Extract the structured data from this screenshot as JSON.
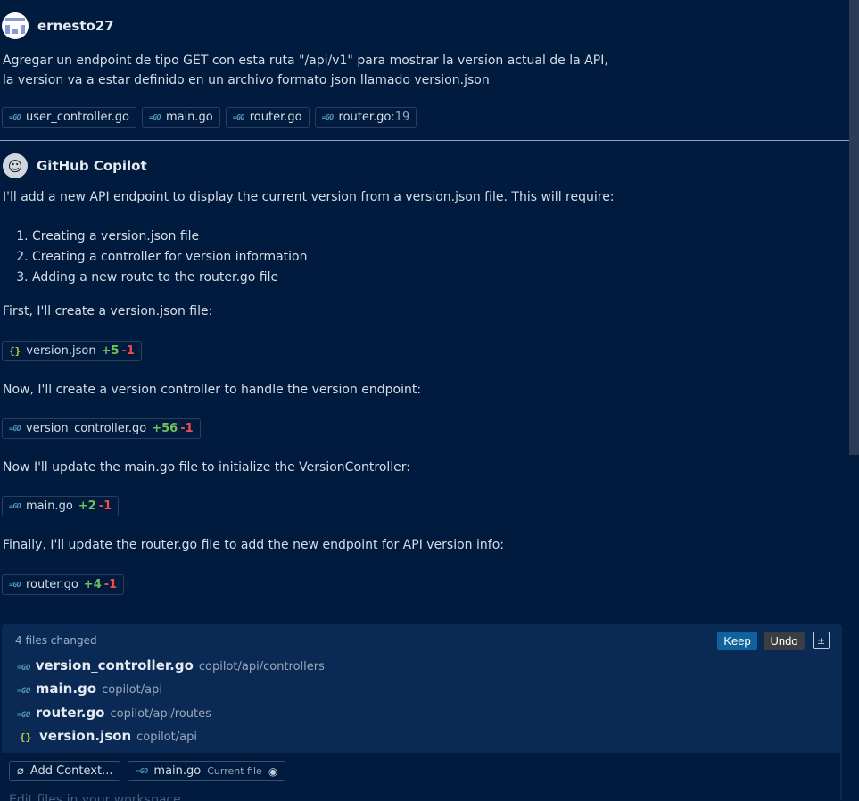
{
  "user": {
    "name": "ernesto27",
    "message_line1": "Agregar un endpoint de tipo GET con esta ruta \"/api/v1\" para mostrar la version actual de la API,",
    "message_line2": "la version va a estar definido en un archivo formato json llamado version.json",
    "attachments": [
      {
        "icon": "go-file-icon",
        "label": "user_controller.go",
        "suffix": ""
      },
      {
        "icon": "go-file-icon",
        "label": "main.go",
        "suffix": ""
      },
      {
        "icon": "go-file-icon",
        "label": "router.go",
        "suffix": ""
      },
      {
        "icon": "go-file-icon",
        "label": "router.go",
        "suffix": ":19"
      }
    ]
  },
  "assistant": {
    "name": "GitHub Copilot",
    "intro": "I'll add a new API endpoint to display the current version from a version.json file. This will require:",
    "steps": [
      "Creating a version.json file",
      "Creating a controller for version information",
      "Adding a new route to the router.go file"
    ],
    "p1": "First, I'll create a version.json file:",
    "edit1": {
      "icon": "json-file-icon",
      "file": "version.json",
      "added": "+5",
      "removed": "-1"
    },
    "p2": "Now, I'll create a version controller to handle the version endpoint:",
    "edit2": {
      "icon": "go-file-icon",
      "file": "version_controller.go",
      "added": "+56",
      "removed": "-1"
    },
    "p3": "Now I'll update the main.go file to initialize the VersionController:",
    "edit3": {
      "icon": "go-file-icon",
      "file": "main.go",
      "added": "+2",
      "removed": "-1"
    },
    "p4": "Finally, I'll update the router.go file to add the new endpoint for API version info:",
    "edit4": {
      "icon": "go-file-icon",
      "file": "router.go",
      "added": "+4",
      "removed": "-1"
    }
  },
  "changes": {
    "title": "4 files changed",
    "keep_label": "Keep",
    "undo_label": "Undo",
    "files": [
      {
        "icon": "go-file-icon",
        "name": "version_controller.go",
        "path": "copilot/api/controllers"
      },
      {
        "icon": "go-file-icon",
        "name": "main.go",
        "path": "copilot/api"
      },
      {
        "icon": "go-file-icon",
        "name": "router.go",
        "path": "copilot/api/routes"
      },
      {
        "icon": "json-file-icon",
        "name": "version.json",
        "path": "copilot/api"
      }
    ]
  },
  "input": {
    "add_context_label": "Add Context...",
    "current_file_name": "main.go",
    "current_file_tag": "Current file",
    "placeholder": "Edit files in your workspace"
  },
  "colors": {
    "background": "#001b3d",
    "added": "#6fbf5b",
    "removed": "#f14c4c",
    "keep_button": "#0e639c",
    "go_icon": "#519aba",
    "json_icon": "#cbcb41"
  }
}
